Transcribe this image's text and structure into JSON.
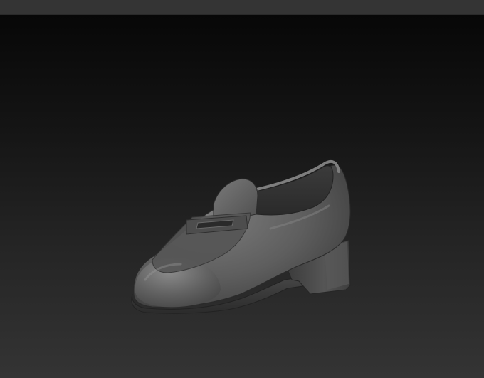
{
  "app": {
    "window_title": ""
  },
  "viewport": {
    "background_top": "#070707",
    "background_bottom": "#343434",
    "model": {
      "name": "loafer-shoe-mesh",
      "material_color": "#5f5f5f",
      "highlight_color": "#8a8a8a",
      "shadow_color": "#262626"
    }
  }
}
